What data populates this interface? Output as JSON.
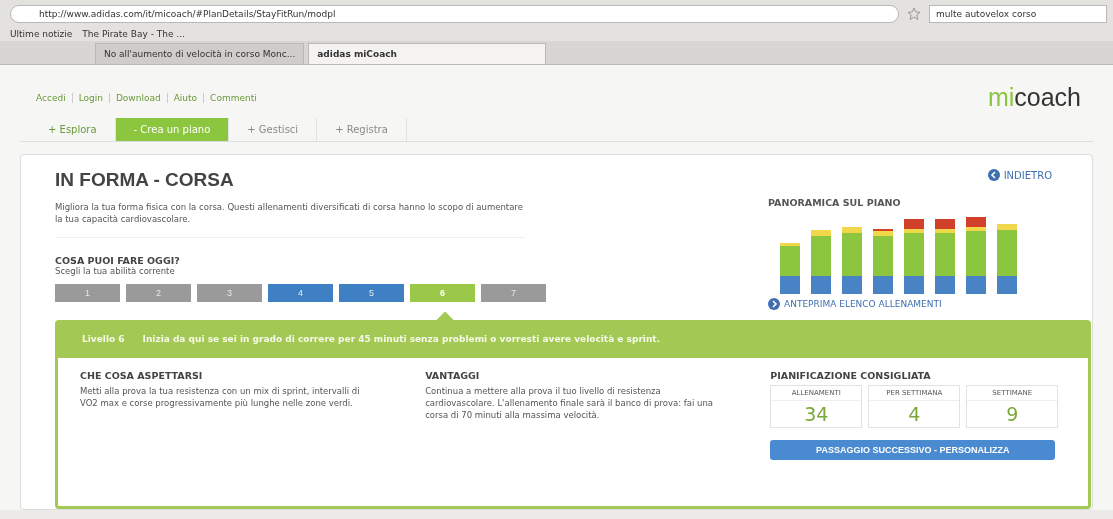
{
  "browser": {
    "address": "http://www.adidas.com/it/micoach/#PlanDetails/StayFitRun/modpl",
    "search": "multe autovelox corso",
    "bookmarks": [
      "Ultime notizie",
      "The Pirate Bay - The ..."
    ],
    "tabs": [
      {
        "label": "No all'aumento di velocità in corso Monc...",
        "selected": false
      },
      {
        "label": "adidas miCoach",
        "selected": true
      }
    ]
  },
  "site": {
    "links": [
      "Accedi",
      "Login",
      "Download",
      "Aiuto",
      "Commenti"
    ],
    "logo_a": "mi",
    "logo_b": "coach",
    "nav": [
      {
        "label": "+ Esplora",
        "selected": false,
        "disabled": false
      },
      {
        "label": "- Crea un piano",
        "selected": true,
        "disabled": false
      },
      {
        "label": "+ Gestisci",
        "selected": false,
        "disabled": true
      },
      {
        "label": "+ Registra",
        "selected": false,
        "disabled": true
      }
    ]
  },
  "plan": {
    "title": "IN FORMA - CORSA",
    "back": "INDIETRO",
    "description": "Migliora la tua forma fisica con la corsa. Questi allenamenti diversificati di corsa hanno lo scopo di aumentare la tua capacità cardiovascolare.",
    "overview_title": "PANORAMICA SUL PIANO",
    "preview_link": "ANTEPRIMA ELENCO ALLENAMENTI",
    "question": "COSA PUOI FARE OGGI?",
    "hint": "Scegli la tua abilità corrente",
    "levels": [
      {
        "label": "1",
        "color": "#9a9a9a",
        "selected": false
      },
      {
        "label": "2",
        "color": "#9a9a9a",
        "selected": false
      },
      {
        "label": "3",
        "color": "#9a9a9a",
        "selected": false
      },
      {
        "label": "4",
        "color": "#3f7fc4",
        "selected": false
      },
      {
        "label": "5",
        "color": "#3f7fc4",
        "selected": false
      },
      {
        "label": "6",
        "color": "#9cc84a",
        "selected": true
      },
      {
        "label": "7",
        "color": "#9a9a9a",
        "selected": false
      }
    ],
    "level_name": "Livello 6",
    "level_text": "Inizia da qui se sei in grado di correre per 45 minuti senza problemi o vorresti avere velocità e sprint.",
    "columns": [
      {
        "title": "CHE COSA ASPETTARSI",
        "text": "Metti alla prova la tua resistenza con un mix di sprint, intervalli di VO2 max e corse progressivamente più lunghe nelle zone verdi."
      },
      {
        "title": "VANTAGGI",
        "text": "Continua a mettere alla prova il tuo livello di resistenza cardiovascolare. L'allenamento finale sarà il banco di prova: fai una corsa di 70 minuti alla massima velocità."
      }
    ],
    "schedule_title": "PIANIFICAZIONE CONSIGLIATA",
    "stats": [
      {
        "label": "ALLENAMENTI",
        "value": "34"
      },
      {
        "label": "PER SETTIMANA",
        "value": "4"
      },
      {
        "label": "SETTIMANE",
        "value": "9"
      }
    ],
    "next_button": "PASSAGGIO SUCCESSIVO - PERSONALIZZA"
  }
}
